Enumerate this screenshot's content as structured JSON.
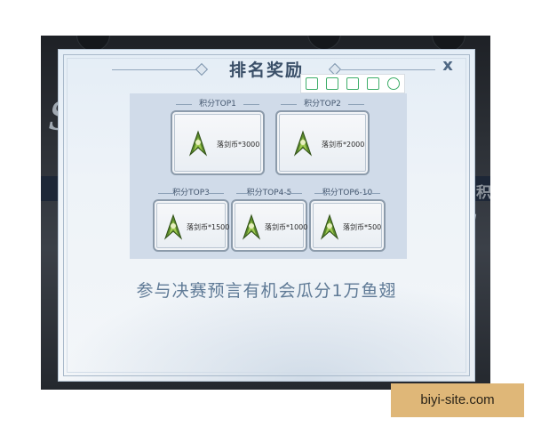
{
  "panel": {
    "title": "排名奖励",
    "close_label": "x",
    "promo_text": "参与决赛预言有机会瓜分1万鱼翅"
  },
  "toolbar_icons": [
    "fit-window-icon",
    "fullscreen-icon",
    "save-icon",
    "export-icon",
    "settings-icon"
  ],
  "rewards": [
    {
      "label": "积分TOP1",
      "item": "落剑币*3000"
    },
    {
      "label": "积分TOP2",
      "item": "落剑币*2000"
    },
    {
      "label": "积分TOP3",
      "item": "落剑币*1500"
    },
    {
      "label": "积分TOP4-5",
      "item": "落剑币*1000"
    },
    {
      "label": "积分TOP6-10",
      "item": "落剑币*500"
    }
  ],
  "background": {
    "partial_char": "积"
  },
  "watermark": "biyi-site.com",
  "colors": {
    "title": "#3a4f68",
    "promo": "#5f7a96",
    "toolbar_accent": "#3fae6a",
    "watermark_bg": "#dfb778"
  }
}
